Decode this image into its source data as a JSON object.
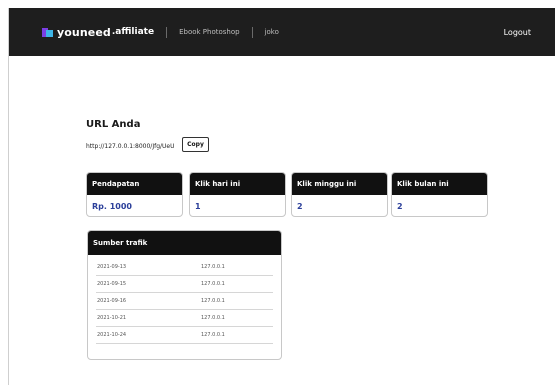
{
  "topbar": {
    "brand": "youneed",
    "brand_suffix": ".affiliate",
    "nav": [
      "Ebook Photoshop",
      "joko"
    ],
    "logout": "Logout"
  },
  "url_section": {
    "title": "URL Anda",
    "url": "http://127.0.0.1:8000/Jfg/UeU",
    "copy_label": "Copy"
  },
  "stats": [
    {
      "label": "Pendapatan",
      "value": "Rp. 1000"
    },
    {
      "label": "Klik hari ini",
      "value": "1"
    },
    {
      "label": "Klik minggu ini",
      "value": "2"
    },
    {
      "label": "Klik bulan ini",
      "value": "2"
    }
  ],
  "traffic": {
    "title": "Sumber trafik",
    "rows": [
      {
        "date": "2021-09-13",
        "ip": "127.0.0.1"
      },
      {
        "date": "2021-09-15",
        "ip": "127.0.0.1"
      },
      {
        "date": "2021-09-16",
        "ip": "127.0.0.1"
      },
      {
        "date": "2021-10-21",
        "ip": "127.0.0.1"
      },
      {
        "date": "2021-10-24",
        "ip": "127.0.0.1"
      }
    ]
  },
  "colors": {
    "topbar_bg": "#1e1e1e",
    "accent_value": "#2b3f9a",
    "logo_purple": "#7b3fe4",
    "logo_blue": "#3fb6e8"
  },
  "icons": [
    "youneed-logo-icon"
  ]
}
